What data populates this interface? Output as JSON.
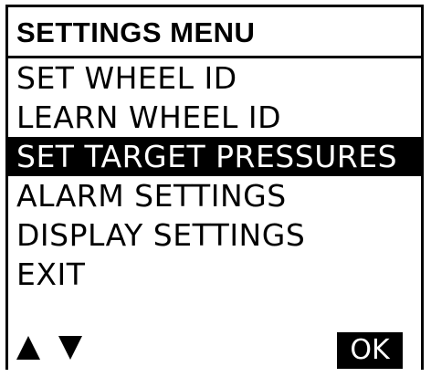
{
  "menu": {
    "title": "SETTINGS MENU",
    "selected_index": 2,
    "items": [
      {
        "label": "SET WHEEL ID"
      },
      {
        "label": "LEARN WHEEL ID"
      },
      {
        "label": "SET TARGET PRESSURES"
      },
      {
        "label": "ALARM SETTINGS"
      },
      {
        "label": "DISPLAY SETTINGS"
      },
      {
        "label": "EXIT"
      }
    ]
  },
  "controls": {
    "up_icon": "triangle-up",
    "down_icon": "triangle-down",
    "ok_label": "OK"
  },
  "colors": {
    "background": "#ffffff",
    "foreground": "#000000",
    "highlight_background": "#000000",
    "highlight_text": "#ffffff"
  }
}
